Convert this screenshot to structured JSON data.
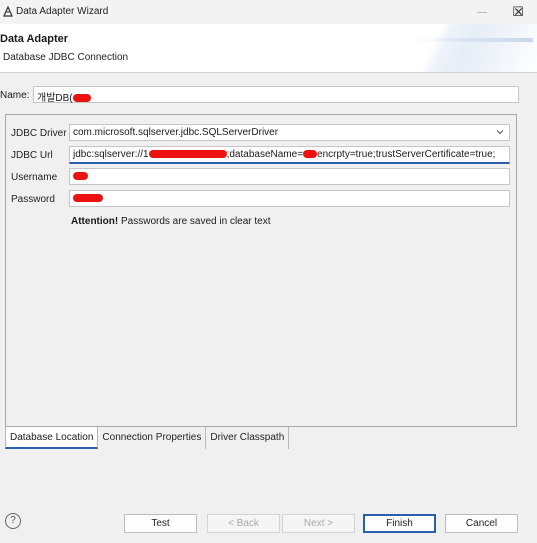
{
  "window": {
    "title": "Data Adapter Wizard",
    "minimize_glyph": "—",
    "maximize_glyph": "☐",
    "close_glyph": "✕"
  },
  "header": {
    "title": "Data Adapter",
    "subtitle": "Database JDBC Connection"
  },
  "name": {
    "label": "Name:",
    "value": "개발DB("
  },
  "form": {
    "jdbc_driver_label": "JDBC Driver",
    "jdbc_driver_value": "com.microsoft.sqlserver.jdbc.SQLServerDriver",
    "jdbc_url_label": "JDBC Url",
    "jdbc_url_prefix": "jdbc:sqlserver://1",
    "jdbc_url_mid": ";databaseName=",
    "jdbc_url_suffix": "encrpty=true;trustServerCertificate=true;",
    "username_label": "Username",
    "password_label": "Password",
    "attention_bold": "Attention!",
    "attention_text": " Passwords are saved in clear text"
  },
  "tabs": [
    {
      "label": "Database Location",
      "active": true
    },
    {
      "label": "Connection Properties",
      "active": false
    },
    {
      "label": "Driver Classpath",
      "active": false
    }
  ],
  "footer": {
    "help_glyph": "?",
    "test": "Test",
    "back": "< Back",
    "next": "Next >",
    "finish": "Finish",
    "cancel": "Cancel"
  },
  "colors": {
    "accent": "#2b5fae",
    "redaction": "#e11111"
  }
}
